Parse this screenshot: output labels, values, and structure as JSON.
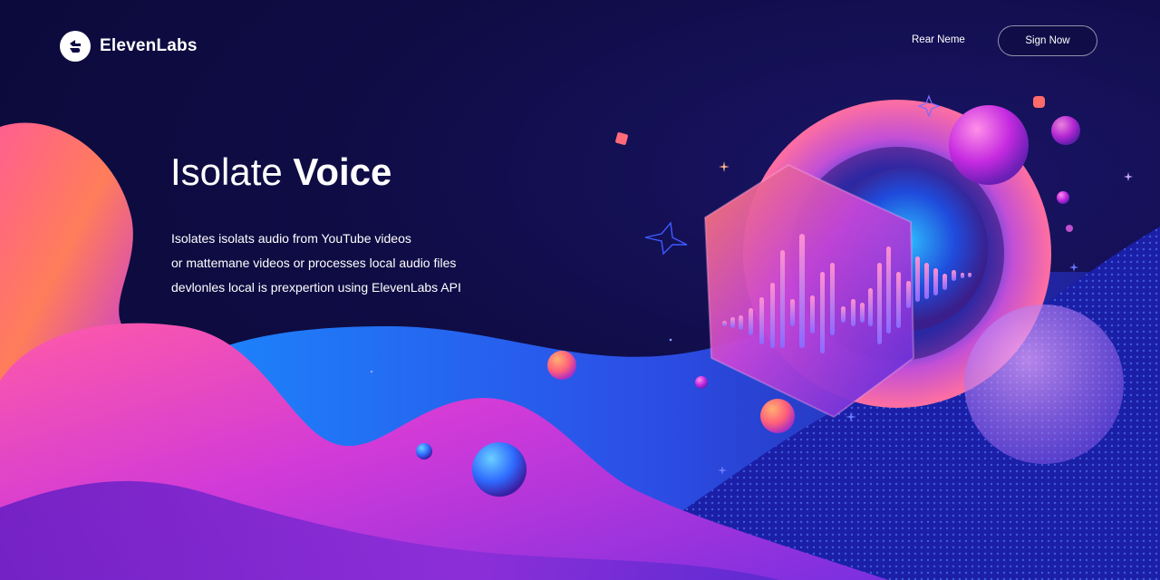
{
  "header": {
    "logo_text": "ElevenLabs",
    "nav_link_label": "Rear Neme",
    "signup_label": "Sign Now"
  },
  "hero": {
    "title_light": "Isolate",
    "title_bold": "Voice",
    "description_lines": [
      "Isolates isolats audio from YouTube videos",
      "or mattemane videos or processes local audio files",
      "devlonles local is prexpertion using ElevenLabs API"
    ]
  },
  "colors": {
    "background": "#0d0b3a",
    "accent_pink": "#e23bd0",
    "accent_orange": "#ff7a5a",
    "accent_blue": "#2f6bff",
    "accent_purple": "#7b2ff2"
  },
  "icons": {
    "logo": "elevenlabs-logo-icon",
    "waveform": "audio-waveform-icon"
  }
}
